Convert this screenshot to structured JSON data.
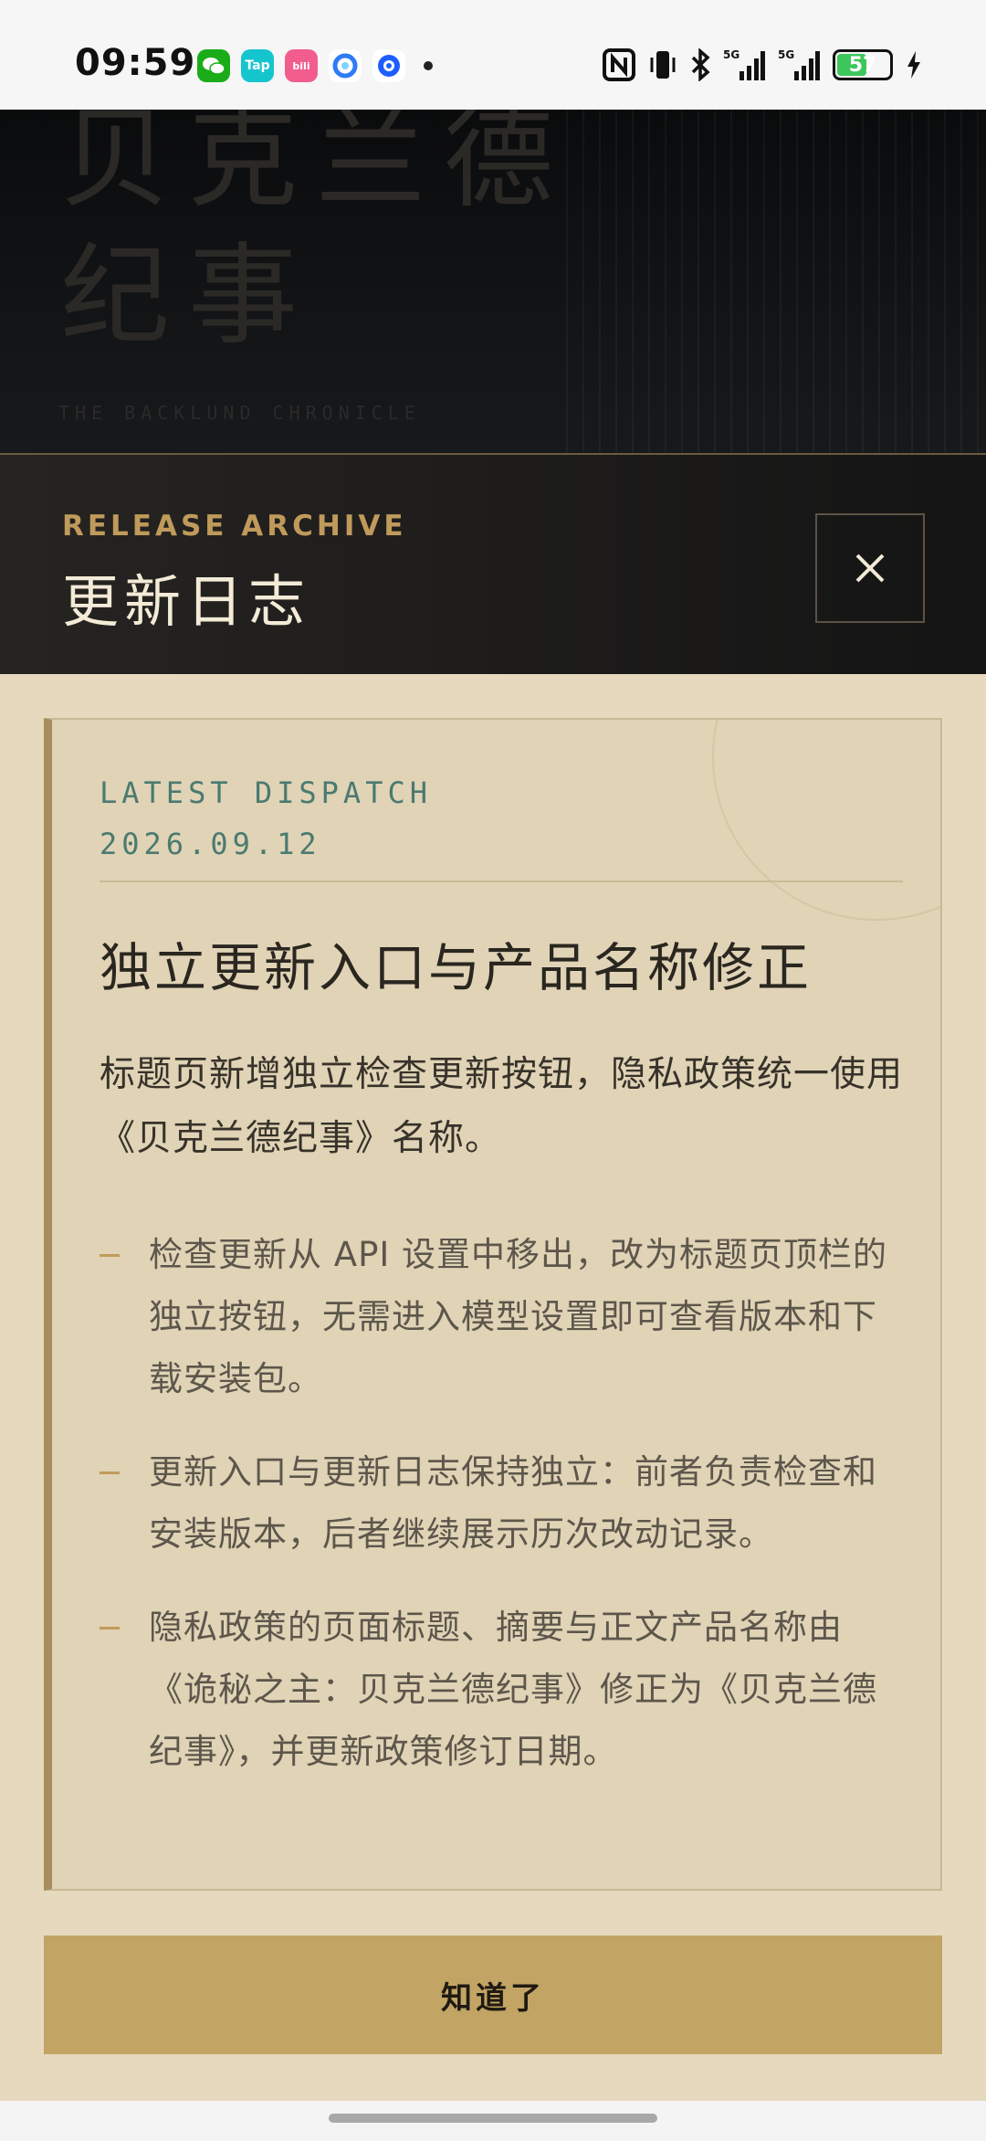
{
  "status_bar": {
    "time": "09:59",
    "apps": [
      {
        "icon": "wechat-icon",
        "label": "",
        "color": "#1aad19"
      },
      {
        "icon": "taptap-icon",
        "label": "Tap",
        "color": "#15c5ce"
      },
      {
        "icon": "bilibili-icon",
        "label": "bili",
        "color": "#f25d8e"
      },
      {
        "icon": "browser-icon",
        "label": "",
        "color": "#2f7bf5"
      },
      {
        "icon": "app-icon",
        "label": "",
        "color": "#1e5eff"
      }
    ],
    "signal_labels": [
      "5G",
      "5G"
    ],
    "battery": "57",
    "battery_level": 0.57,
    "battery_color": "#3cc65b"
  },
  "background": {
    "title_line1": "贝克兰德",
    "title_line2": "纪事",
    "subtitle": "THE BACKLUND CHRONICLE"
  },
  "modal": {
    "eyebrow": "RELEASE ARCHIVE",
    "title": "更新日志",
    "close_icon": "close-icon",
    "card": {
      "label": "LATEST DISPATCH",
      "date": "2026.09.12",
      "title": "独立更新入口与产品名称修正",
      "summary": "标题页新增独立检查更新按钮，隐私政策统一使用《贝克兰德纪事》名称。",
      "items": [
        "检查更新从 API 设置中移出，改为标题页顶栏的独立按钮，无需进入模型设置即可查看版本和下载安装包。",
        "更新入口与更新日志保持独立：前者负责检查和安装版本，后者继续展示历次改动记录。",
        "隐私政策的页面标题、摘要与正文产品名称由《诡秘之主：贝克兰德纪事》修正为《贝克兰德纪事》，并更新政策修订日期。"
      ]
    },
    "confirm_label": "知道了"
  },
  "colors": {
    "accent_gold": "#c2a464",
    "teal": "#4a7a70",
    "header_dark": "#1c1b1a"
  }
}
